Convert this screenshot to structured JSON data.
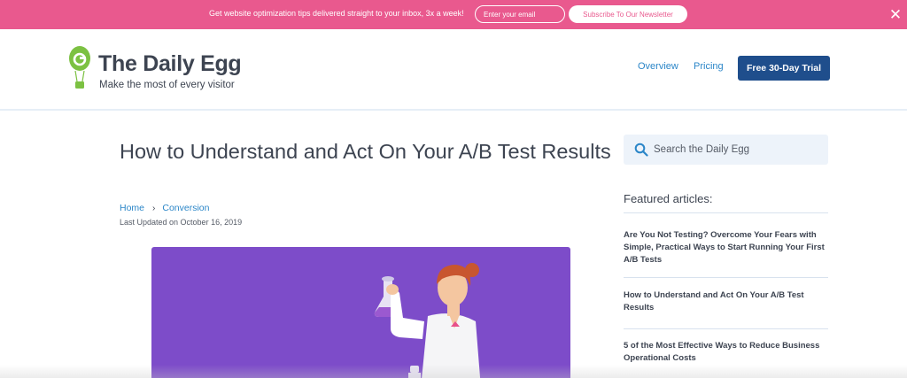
{
  "promo": {
    "text": "Get website optimization tips delivered straight to your inbox, 3x a week!",
    "email_placeholder": "Enter your email",
    "subscribe_label": "Subscribe To Our Newsletter",
    "close_glyph": "✕"
  },
  "header": {
    "brand_title": "The Daily Egg",
    "brand_tagline": "Make the most of every visitor",
    "nav": {
      "overview": "Overview",
      "pricing": "Pricing",
      "trial": "Free 30-Day Trial"
    }
  },
  "article": {
    "title": "How to Understand and Act On Your A/B Test Results",
    "breadcrumb": [
      "Home",
      "Conversion"
    ],
    "breadcrumb_separator": "›",
    "updated": "Last Updated on October 16, 2019"
  },
  "sidebar": {
    "search_placeholder": "Search the Daily Egg",
    "featured_heading": "Featured articles:",
    "featured": [
      "Are You Not Testing? Overcome Your Fears with Simple, Practical Ways to Start Running Your First A/B Tests",
      "How to Understand and Act On Your A/B Test Results",
      "5 of the Most Effective Ways to Reduce Business Operational Costs"
    ]
  },
  "colors": {
    "promo_bg": "#e9598e",
    "brand_green": "#7cc142",
    "link_blue": "#2b86c8",
    "button_navy": "#1f4e8c",
    "hero_purple": "#7d4cc9",
    "search_bg": "#edf3fa"
  },
  "icons": [
    "egg-balloon-logo-icon",
    "chevron-right-icon",
    "search-icon",
    "close-icon"
  ]
}
